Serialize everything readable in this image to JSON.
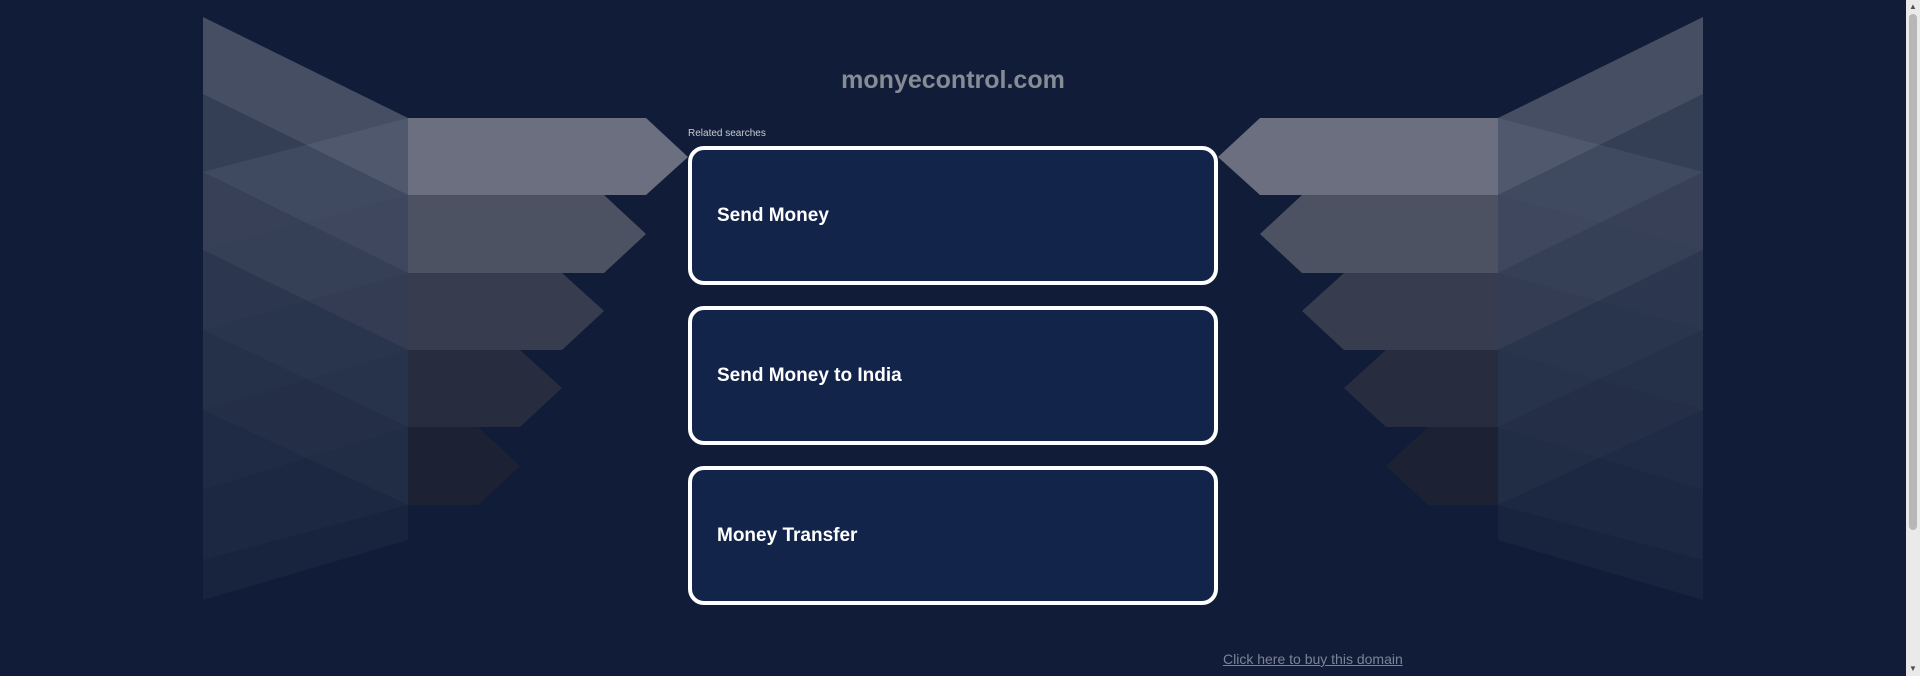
{
  "page": {
    "domain": "monyecontrol.com",
    "related_label": "Related searches",
    "buy_link": "Click here to buy this domain"
  },
  "searches": [
    {
      "label": "Send Money"
    },
    {
      "label": "Send Money to India"
    },
    {
      "label": "Money Transfer"
    }
  ],
  "scrollbar": {
    "up_icon": "scroll-up-arrow-icon",
    "down_icon": "scroll-down-arrow-icon"
  },
  "colors": {
    "background": "#111d38",
    "card_fill": "#13244b",
    "card_border": "#ffffff",
    "title": "#868b95",
    "link": "#7d8396"
  }
}
